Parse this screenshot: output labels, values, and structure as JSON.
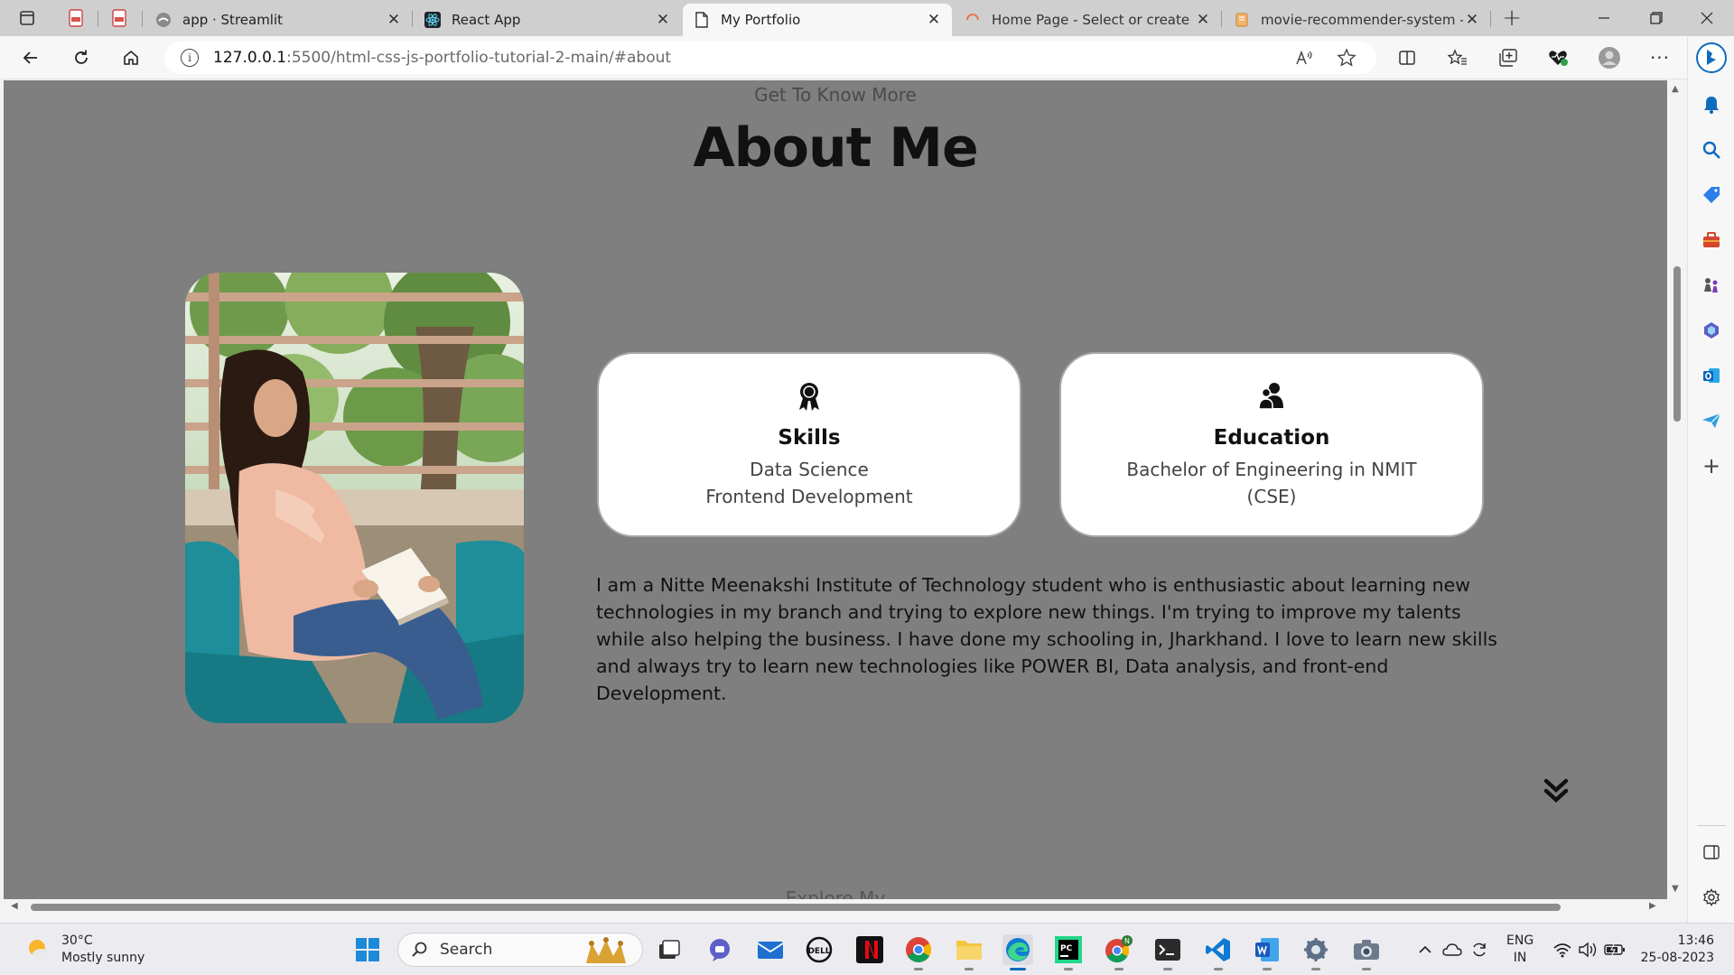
{
  "browser": {
    "tabs": [
      {
        "title": "app · Streamlit",
        "icon": "streamlit-icon"
      },
      {
        "title": "React App",
        "icon": "react-icon"
      },
      {
        "title": "My Portfolio",
        "icon": "page-icon",
        "active": true
      },
      {
        "title": "Home Page - Select or create a n",
        "icon": "loading-icon"
      },
      {
        "title": "movie-recommender-system - Ju",
        "icon": "jupyter-icon"
      }
    ],
    "address": {
      "host": "127.0.0.1",
      "path": ":5500/html-css-js-portfolio-tutorial-2-main/#about"
    }
  },
  "about": {
    "subtitle": "Get To Know More",
    "title": "About Me",
    "photo_alt": "Portrait photo of a girl reading a book",
    "cards": [
      {
        "icon": "award-icon",
        "title": "Skills",
        "lines": [
          "Data Science",
          "Frontend Development"
        ]
      },
      {
        "icon": "education-icon",
        "title": "Education",
        "lines": [
          "Bachelor of Engineering in NMIT",
          "(CSE)"
        ]
      }
    ],
    "bio": "I am a Nitte Meenakshi Institute of Technology student who is enthusiastic about learning new technologies in my branch and trying to explore new things. I'm trying to improve my talents while also helping the business. I have done my schooling in, Jharkhand. I love to learn new skills and always try to learn new technologies like POWER BI, Data analysis, and front-end Development.",
    "next_section_peek": "Explore My"
  },
  "taskbar": {
    "weather": {
      "temp": "30°C",
      "desc": "Mostly sunny"
    },
    "search_placeholder": "Search",
    "lang": [
      "ENG",
      "IN"
    ],
    "time": "13:46",
    "date": "25-08-2023"
  },
  "colors": {
    "page_bg": "#7f7f7f",
    "card_bg": "#ffffff",
    "edge_accent": "#0f6cbd"
  }
}
